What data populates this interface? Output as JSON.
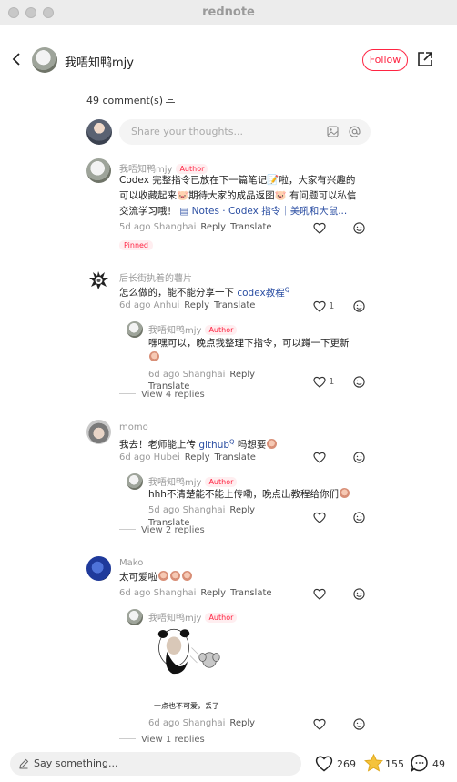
{
  "window": {
    "title": "rednote"
  },
  "header": {
    "author_name": "我唔知鸭mjy",
    "follow_label": "Follow"
  },
  "comments_header": {
    "count_label": "49 comment(s)"
  },
  "share_input": {
    "placeholder": "Share your thoughts..."
  },
  "comments": [
    {
      "name": "我唔知鸭mjy",
      "tag": "Author",
      "lines": [
        "Codex 完整指令已放在下一篇笔记📝啦，大家有兴趣的",
        "可以收藏起来🐷期待大家的成品返图🐷 有问题可以私信",
        "交流学习哦！"
      ],
      "link_text": "Notes · Codex 指令｜美吼和大鼠...",
      "meta": "5d ago Shanghai",
      "reply": "Reply",
      "translate": "Translate",
      "pinned": "Pinned"
    },
    {
      "name": "后长街执着的薯片",
      "text": "怎么做的，能不能分享一下 ",
      "link_text": "codex教程",
      "meta": "6d ago Anhui",
      "reply": "Reply",
      "translate": "Translate",
      "likes": "1",
      "sub": {
        "name": "我唔知鸭mjy",
        "tag": "Author",
        "lines": [
          "嘿嘿可以，晚点我整理下指令，可以蹲一下更新"
        ],
        "meta": "6d ago Shanghai",
        "reply": "Reply",
        "translate": "Translate",
        "likes": "1"
      },
      "view_replies": "View 4 replies"
    },
    {
      "name": "momo",
      "text": "我去！老师能上传 ",
      "link_text": "github",
      "text_after": " 吗想要",
      "meta": "6d ago Hubei",
      "reply": "Reply",
      "translate": "Translate",
      "sub": {
        "name": "我唔知鸭mjy",
        "tag": "Author",
        "lines": [
          "hhh不清楚能不能上传嘞，晚点出教程给你们"
        ],
        "meta": "5d ago Shanghai",
        "reply": "Reply",
        "translate": "Translate"
      },
      "view_replies": "View 2 replies"
    },
    {
      "name": "Mako",
      "text": "太可爱啦",
      "meta": "6d ago Shanghai",
      "reply": "Reply",
      "translate": "Translate",
      "sub": {
        "name": "我唔知鸭mjy",
        "tag": "Author",
        "sticker_caption": "一点也不可爱，丢了",
        "meta": "6d ago Shanghai",
        "reply": "Reply"
      },
      "view_replies": "View 1 replies"
    }
  ],
  "footer": {
    "placeholder": "Say something...",
    "likes": "269",
    "stars": "155",
    "comments": "49"
  },
  "colors": {
    "accent": "#ff2442",
    "link": "#2c4fa3",
    "star": "#f5c33b"
  }
}
